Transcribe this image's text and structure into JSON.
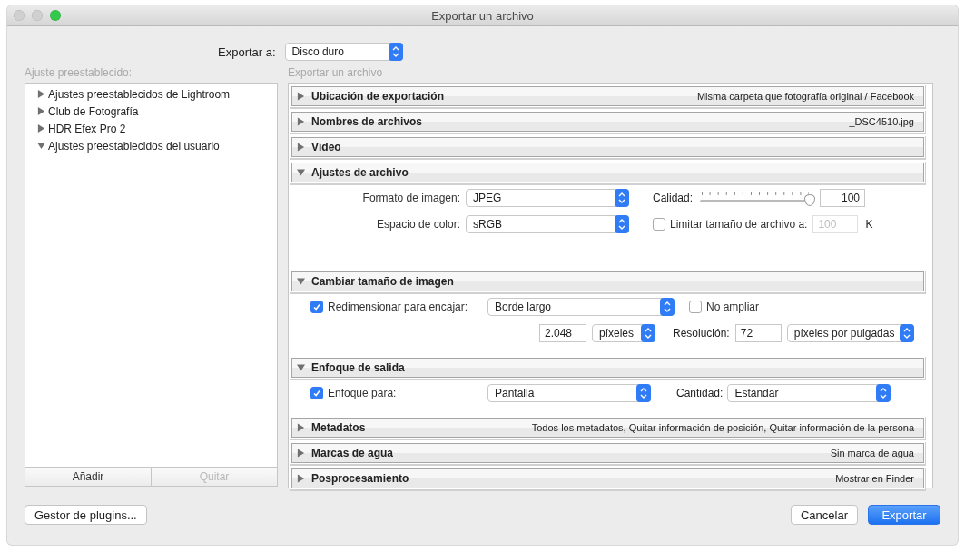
{
  "window": {
    "title": "Exportar un archivo",
    "controls": [
      {
        "kind": "close",
        "disabled": true
      },
      {
        "kind": "minimize",
        "disabled": true
      },
      {
        "kind": "zoom",
        "disabled": false
      }
    ]
  },
  "export_to": {
    "label": "Exportar a:",
    "value": "Disco duro"
  },
  "presets": {
    "label": "Ajuste preestablecido:",
    "items": [
      {
        "label": "Ajustes preestablecidos de Lightroom",
        "expanded": false
      },
      {
        "label": "Club de Fotografía",
        "expanded": false
      },
      {
        "label": "HDR Efex Pro 2",
        "expanded": false
      },
      {
        "label": "Ajustes preestablecidos del usuario",
        "expanded": true
      }
    ],
    "buttons": [
      {
        "label": "Añadir",
        "disabled": false
      },
      {
        "label": "Quitar",
        "disabled": true
      }
    ]
  },
  "panel_label": "Exportar un archivo",
  "sections": [
    {
      "title": "Ubicación de exportación",
      "summary": "Misma carpeta que fotografía original / Facebook",
      "expanded": false
    },
    {
      "title": "Nombres de archivos",
      "summary": "_DSC4510.jpg",
      "expanded": false
    },
    {
      "title": "Vídeo",
      "expanded": false
    },
    {
      "title": "Ajustes de archivo",
      "expanded": true,
      "body": {
        "kind": "file_settings",
        "format": {
          "label": "Formato de imagen:",
          "value": "JPEG"
        },
        "color_space": {
          "label": "Espacio de color:",
          "value": "sRGB"
        },
        "quality": {
          "label": "Calidad:",
          "level": 0.97,
          "value": "100"
        },
        "limit": {
          "label": "Limitar tamaño de archivo a:",
          "checked": false,
          "value": "100",
          "disabled": true,
          "unit": "K"
        }
      }
    },
    {
      "title": "Cambiar tamaño de imagen",
      "expanded": true,
      "body": {
        "kind": "resize",
        "fit": {
          "label": "Redimensionar para encajar:",
          "checked": true,
          "value": "Borde largo"
        },
        "no_enlarge": {
          "label": "No ampliar",
          "checked": false
        },
        "size": {
          "value": "2.048",
          "unit": "píxeles"
        },
        "resolution": {
          "label": "Resolución:",
          "value": "72",
          "unit": "píxeles por pulgadas"
        }
      }
    },
    {
      "title": "Enfoque de salida",
      "expanded": true,
      "body": {
        "kind": "sharpening",
        "sharpen": {
          "label": "Enfoque para:",
          "checked": true,
          "value": "Pantalla"
        },
        "amount": {
          "label": "Cantidad:",
          "value": "Estándar"
        }
      }
    },
    {
      "title": "Metadatos",
      "summary": "Todos los metadatos, Quitar información de posición, Quitar información de la persona",
      "expanded": false
    },
    {
      "title": "Marcas de agua",
      "summary": "Sin marca de agua",
      "expanded": false
    },
    {
      "title": "Posprocesamiento",
      "summary": "Mostrar en Finder",
      "expanded": false
    }
  ],
  "footer": {
    "plugins": "Gestor de plugins...",
    "cancel": "Cancelar",
    "export": "Exportar"
  }
}
